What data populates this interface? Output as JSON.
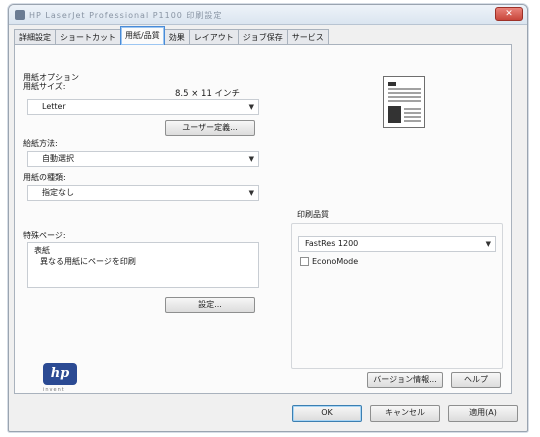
{
  "window": {
    "title": "HP LaserJet Professional P1100 印刷設定",
    "close_label": "✕"
  },
  "tabs": [
    {
      "label": "詳細設定",
      "active": false
    },
    {
      "label": "ショートカット",
      "active": false
    },
    {
      "label": "用紙/品質",
      "active": true
    },
    {
      "label": "効果",
      "active": false
    },
    {
      "label": "レイアウト",
      "active": false
    },
    {
      "label": "ジョブ保存",
      "active": false
    },
    {
      "label": "サービス",
      "active": false
    }
  ],
  "paper_options": {
    "group_label": "用紙オプション",
    "size_label": "用紙サイズ:",
    "size_dimensions": "8.5 × 11 インチ",
    "size_value": "Letter",
    "custom_button": "ユーザー定義...",
    "source_label": "給紙方法:",
    "source_value": "自動選択",
    "type_label": "用紙の種類:",
    "type_value": "指定なし"
  },
  "special_pages": {
    "label": "特殊ページ:",
    "items": [
      "表紙",
      "異なる用紙にページを印刷"
    ],
    "settings_button": "設定..."
  },
  "print_quality": {
    "label": "印刷品質",
    "value": "FastRes 1200",
    "economode_label": "EconoMode",
    "economode_checked": false
  },
  "footer": {
    "version_button": "バージョン情報...",
    "help_button": "ヘルプ",
    "ok_button": "OK",
    "cancel_button": "キャンセル",
    "apply_button": "適用(A)"
  },
  "branding": {
    "logo_text": "hp",
    "logo_sub": "invent"
  }
}
